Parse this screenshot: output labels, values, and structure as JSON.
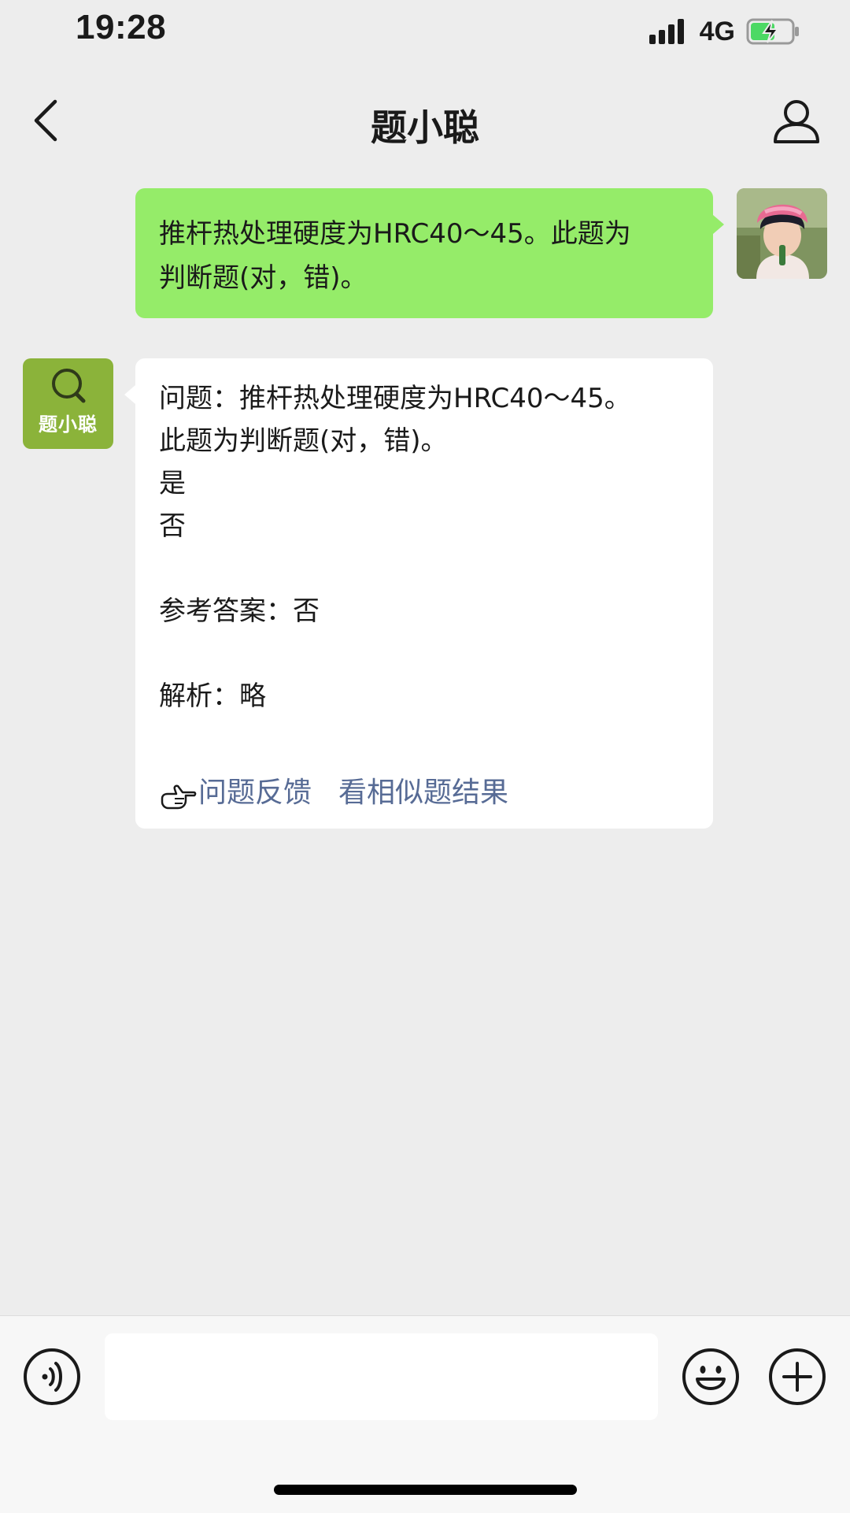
{
  "status_bar": {
    "time": "19:28",
    "network": "4G",
    "battery_state": "charging"
  },
  "nav": {
    "title": "题小聪",
    "back_icon": "chevron-left-icon",
    "profile_icon": "person-icon"
  },
  "messages": {
    "user": {
      "lines": [
        "推杆热处理硬度为HRC40～45。此题为",
        "判断题(对，错)。"
      ]
    },
    "bot": {
      "avatar_label": "题小聪",
      "avatar_color": "#8bb33a",
      "lines": {
        "question_1": "问题：推杆热处理硬度为HRC40～45。",
        "question_2": "此题为判断题(对，错)。",
        "option_yes": "是",
        "option_no": "否",
        "answer": "参考答案：否",
        "analysis": "解析：略"
      },
      "actions": {
        "feedback": "问题反馈",
        "similar": "看相似题结果"
      }
    }
  },
  "input_bar": {
    "voice_icon": "voice-icon",
    "emoji_icon": "emoji-icon",
    "plus_icon": "plus-icon",
    "text_value": ""
  },
  "colors": {
    "user_bubble": "#95ec69",
    "bot_bubble": "#ffffff",
    "link": "#576b95",
    "background": "#ededed"
  }
}
